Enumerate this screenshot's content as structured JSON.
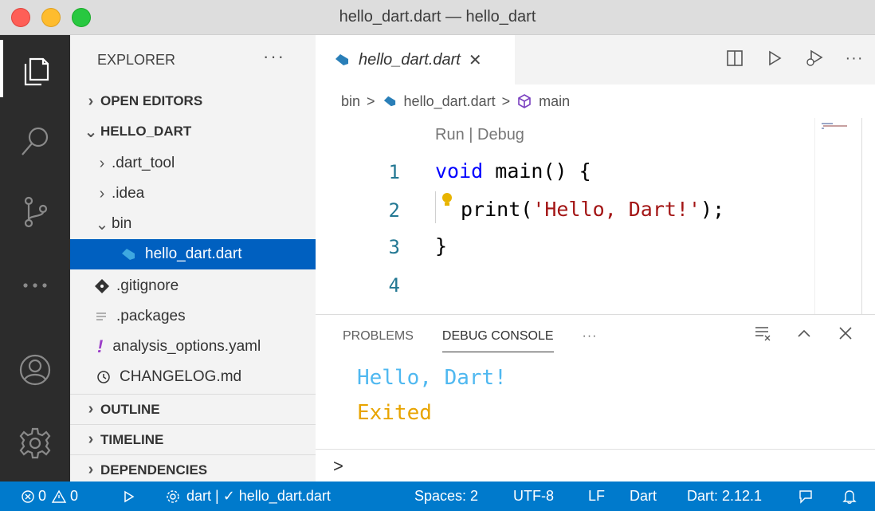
{
  "window": {
    "title": "hello_dart.dart — hello_dart"
  },
  "explorer": {
    "title": "EXPLORER",
    "more": "···",
    "sections": {
      "open_editors": "OPEN EDITORS",
      "project": "HELLO_DART",
      "outline": "OUTLINE",
      "timeline": "TIMELINE",
      "dependencies": "DEPENDENCIES"
    },
    "tree": {
      "dart_tool": ".dart_tool",
      "idea": ".idea",
      "bin": "bin",
      "hello_dart": "hello_dart.dart",
      "gitignore": ".gitignore",
      "packages": ".packages",
      "analysis_options_prefix": "!",
      "analysis_options": "analysis_options.yaml",
      "changelog": "CHANGELOG.md"
    }
  },
  "tabs": [
    {
      "label": "hello_dart.dart",
      "close": "✕"
    }
  ],
  "breadcrumb": {
    "folder": "bin",
    "file": "hello_dart.dart",
    "symbol": "main",
    "sep": ">"
  },
  "editor": {
    "codelens": "Run | Debug",
    "line_numbers": [
      "1",
      "2",
      "3",
      "4"
    ],
    "lines": {
      "l1_kw": "void",
      "l1_rest": " main() {",
      "l2_pre": "print(",
      "l2_str": "'Hello, Dart!'",
      "l2_post": ");",
      "l3": "}"
    }
  },
  "panel": {
    "tabs": [
      "PROBLEMS",
      "DEBUG CONSOLE"
    ],
    "more": "···",
    "output": [
      "Hello, Dart!",
      "Exited"
    ],
    "output_colors": [
      "#4fb8f0",
      "#e8a400"
    ],
    "prompt": ">"
  },
  "status": {
    "errors": "0",
    "warnings": "0",
    "launch": "dart | ✓ hello_dart.dart",
    "spaces": "Spaces: 2",
    "encoding": "UTF-8",
    "eol": "LF",
    "language": "Dart",
    "sdk": "Dart: 2.12.1"
  },
  "colors": {
    "accent": "#007acc",
    "selection": "#0060c0",
    "activity_bg": "#2c2c2c",
    "dart_icon": "#2a9fd6"
  }
}
